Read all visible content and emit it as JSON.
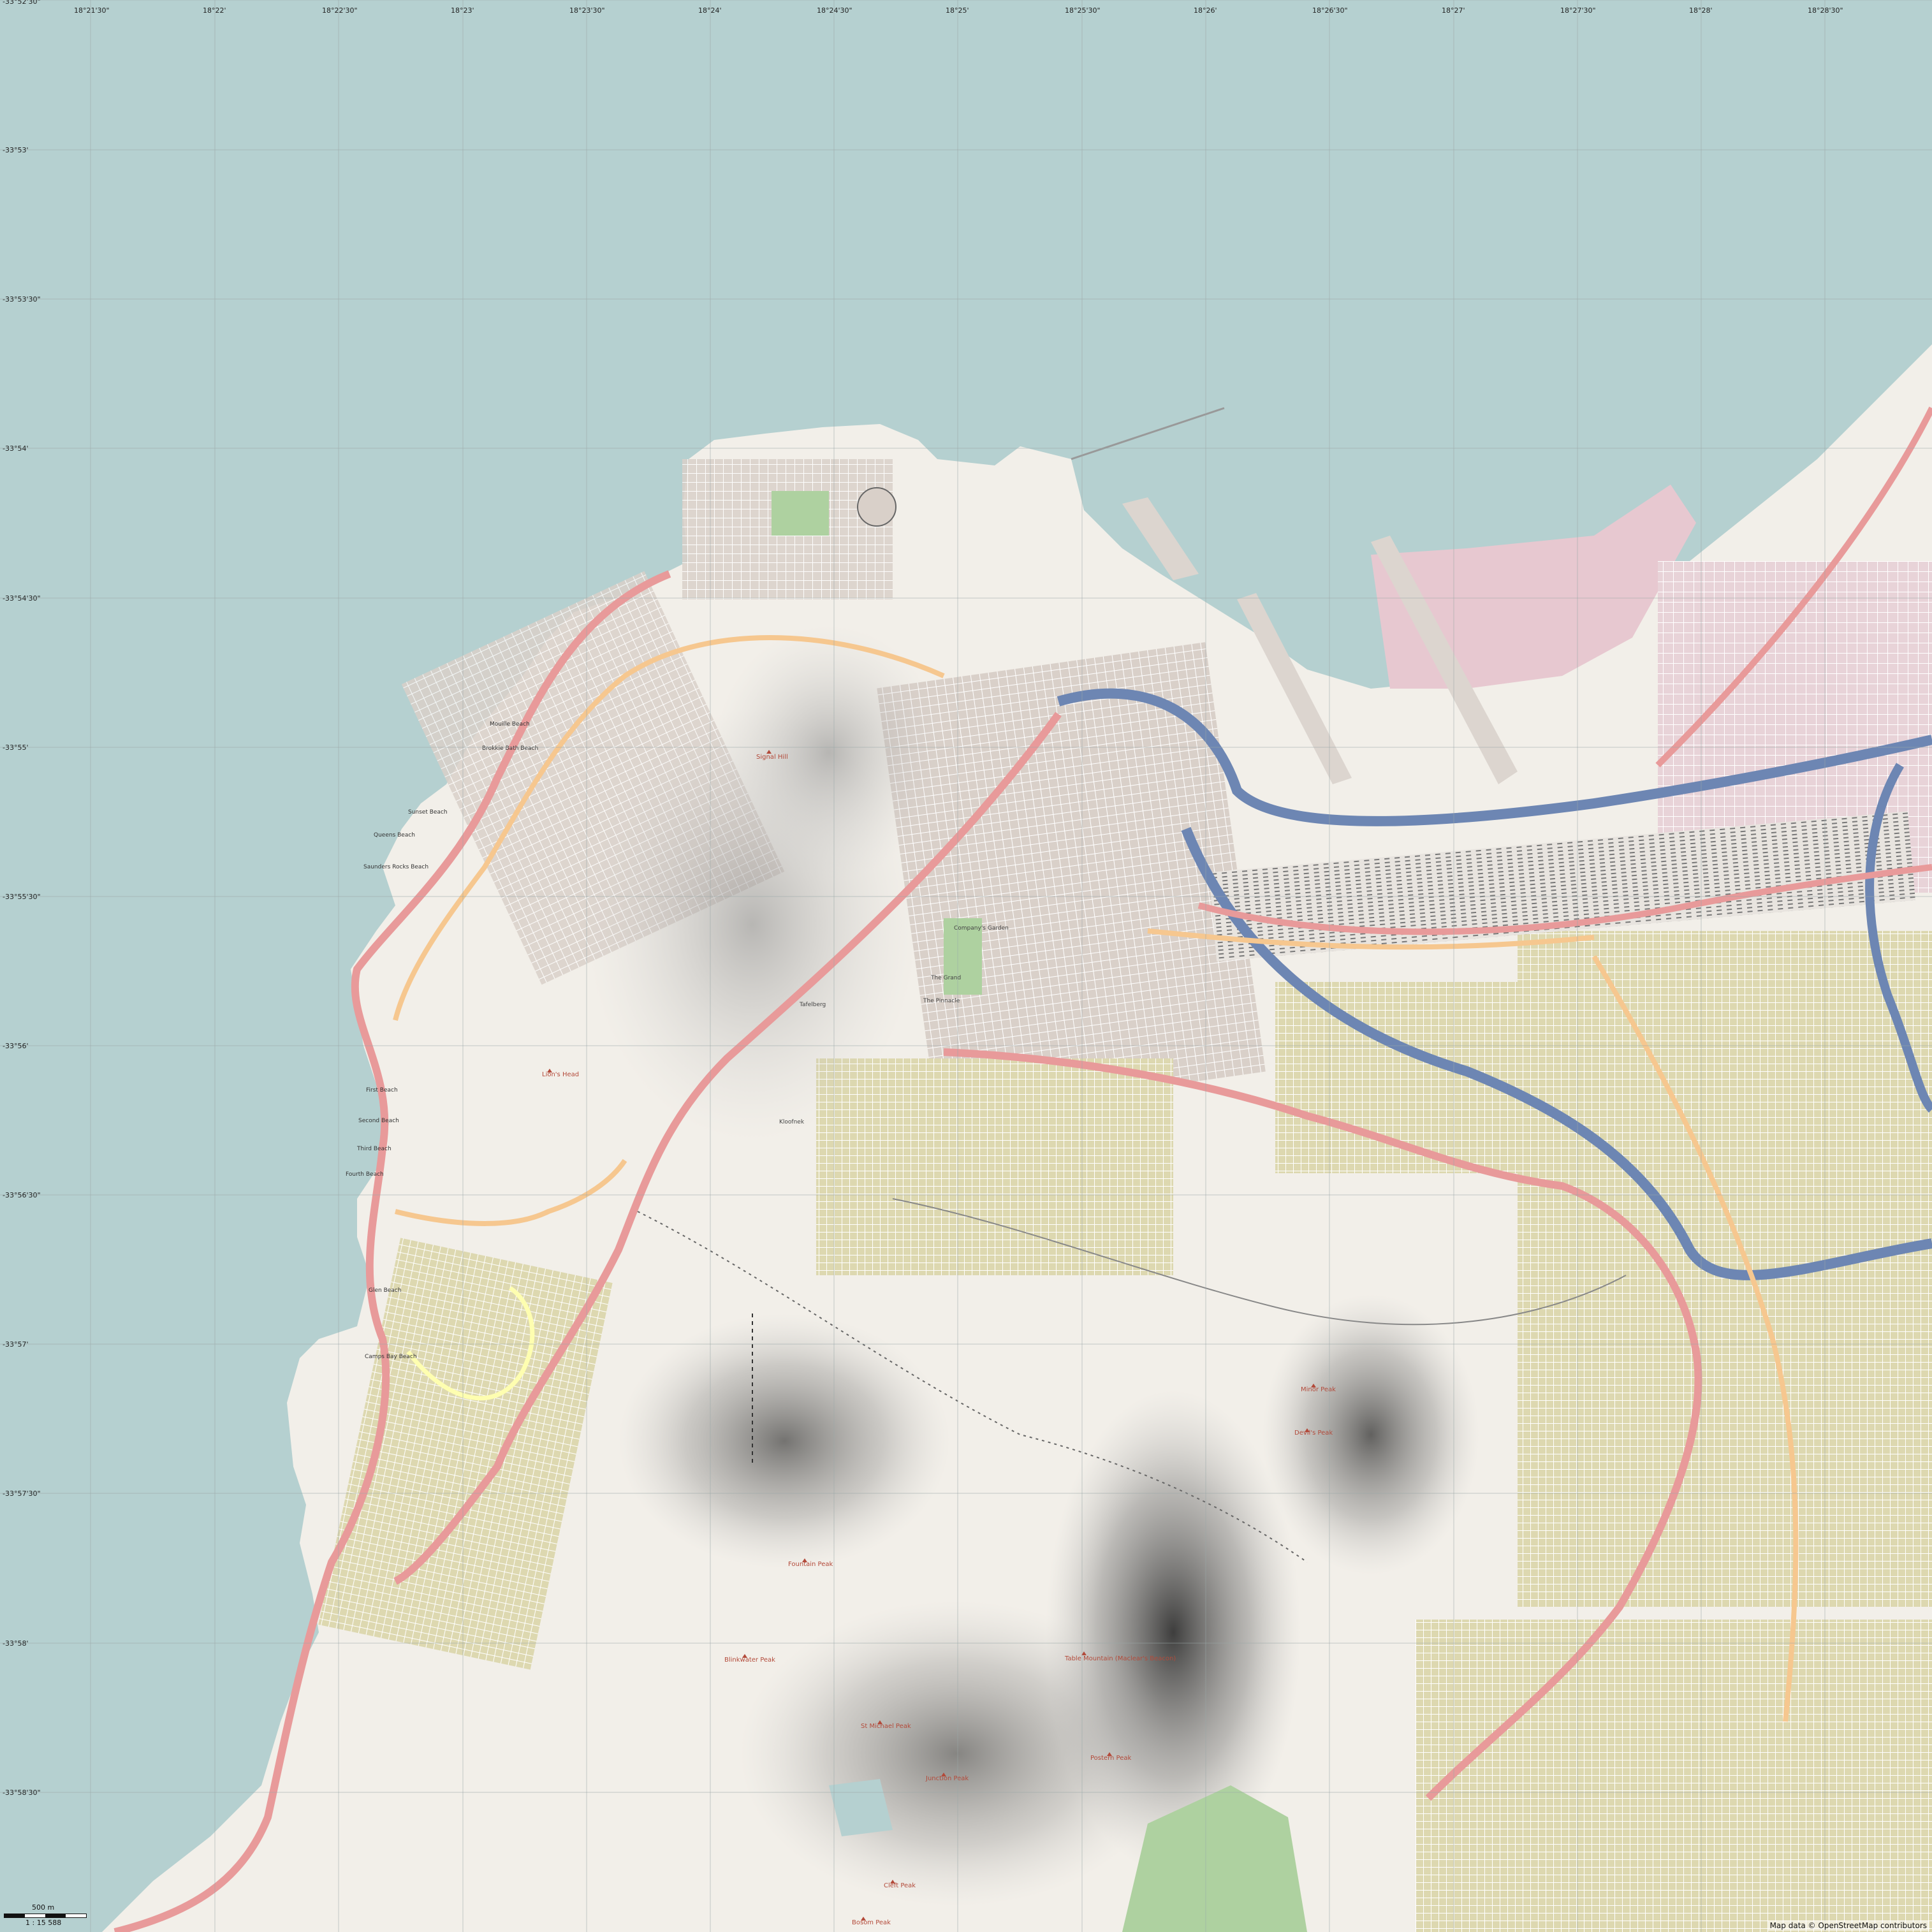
{
  "colors": {
    "water": "#b5d0d0",
    "land": "#f2efe9",
    "mountain_shade": "#3a3a3a",
    "urban": "#d9d0c9",
    "residential": "#ddd8b0",
    "park": "#aed1a0",
    "motorway": "#6d86b3",
    "primary": "#e89a9a",
    "secondary": "#f6c78f",
    "tertiary": "#fefeb0",
    "industrial": "#e7c8d0",
    "peak": "#b34a3a"
  },
  "grid": {
    "top_labels": [
      "18°21'30\"",
      "18°22'",
      "18°22'30\"",
      "18°23'",
      "18°23'30\"",
      "18°24'",
      "18°24'30\"",
      "18°25'",
      "18°25'30\"",
      "18°26'",
      "18°26'30\"",
      "18°27'",
      "18°27'30\"",
      "18°28'",
      "18°28'30\""
    ],
    "left_labels": [
      "-33°52'30\"",
      "-33°53'",
      "-33°53'30\"",
      "-33°54'",
      "-33°54'30\"",
      "-33°55'",
      "-33°55'30\"",
      "-33°56'",
      "-33°56'30\"",
      "-33°57'",
      "-33°57'30\"",
      "-33°58'",
      "-33°58'30\""
    ]
  },
  "peaks": [
    {
      "id": "lions-head",
      "label": "Lion's Head"
    },
    {
      "id": "signal-hill",
      "label": "Signal Hill"
    },
    {
      "id": "maclears-beacon",
      "label": "Maclear's Beacon"
    },
    {
      "id": "devils-peak",
      "label": "Devil's Peak"
    },
    {
      "id": "minor-peak",
      "label": "Minor Peak"
    },
    {
      "id": "table-mountain",
      "label": "Table Mountain (Maclear's Beacon)"
    },
    {
      "id": "blinkwater-peak",
      "label": "Blinkwater Peak"
    },
    {
      "id": "st-michael-peak",
      "label": "St Michael Peak"
    },
    {
      "id": "junction-peak",
      "label": "Junction Peak"
    },
    {
      "id": "grootkop-peak",
      "label": "Fountain Peak"
    },
    {
      "id": "cleft-peak",
      "label": "Cleft Peak"
    },
    {
      "id": "bosom-peak",
      "label": "Bosom Peak"
    },
    {
      "id": "postern-peak",
      "label": "Postern Peak"
    }
  ],
  "beaches": [
    {
      "id": "mouille-beach",
      "label": "Mouille Beach"
    },
    {
      "id": "brokkie-bath",
      "label": "Brokkie Bath Beach"
    },
    {
      "id": "sunset-beach",
      "label": "Sunset Beach"
    },
    {
      "id": "queens-beach",
      "label": "Queens Beach"
    },
    {
      "id": "saunders-rocks",
      "label": "Saunders Rocks Beach"
    },
    {
      "id": "first-beach",
      "label": "First Beach"
    },
    {
      "id": "second-beach",
      "label": "Second Beach"
    },
    {
      "id": "third-beach",
      "label": "Third Beach"
    },
    {
      "id": "fourth-beach",
      "label": "Fourth Beach"
    },
    {
      "id": "glen-beach",
      "label": "Glen Beach"
    },
    {
      "id": "camps-bay-beach",
      "label": "Camps Bay Beach"
    }
  ],
  "pois": [
    {
      "id": "company-garden",
      "label": "Company's Garden"
    },
    {
      "id": "the-grand",
      "label": "The Grand"
    },
    {
      "id": "the-pinnacle",
      "label": "The Pinnacle"
    },
    {
      "id": "tafelberg",
      "label": "Tafelberg"
    },
    {
      "id": "kloofnek",
      "label": "Kloofnek"
    }
  ],
  "scale": {
    "distance": "500 m",
    "ratio": "1 : 15 588"
  },
  "attribution": "Map data © OpenStreetMap contributors"
}
